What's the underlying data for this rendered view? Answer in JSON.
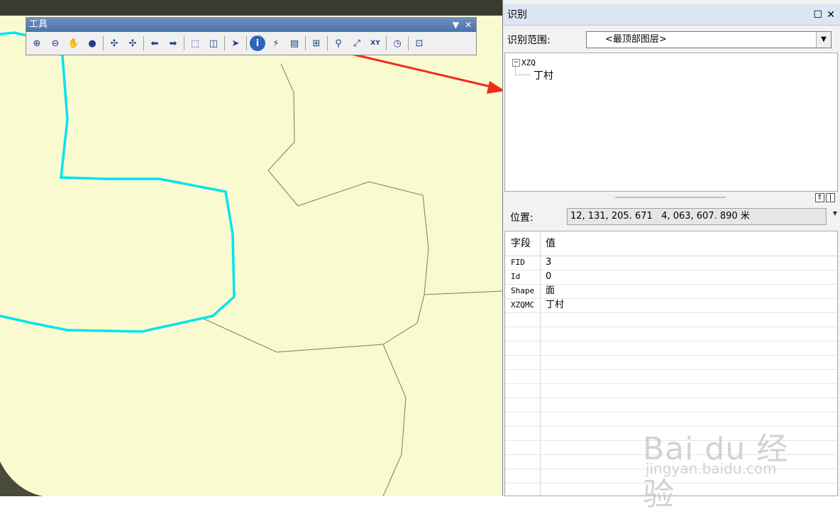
{
  "toolbar": {
    "title": "工具",
    "tools": [
      {
        "icon": "zoom-in-icon",
        "glyph": "⊕"
      },
      {
        "icon": "zoom-out-icon",
        "glyph": "⊖"
      },
      {
        "icon": "pan-hand-icon",
        "glyph": "✋"
      },
      {
        "icon": "full-extent-globe-icon",
        "glyph": "●"
      },
      {
        "icon": "fixed-zoom-in-icon",
        "glyph": "✣"
      },
      {
        "icon": "fixed-zoom-out-icon",
        "glyph": "✣"
      },
      {
        "icon": "back-arrow-icon",
        "glyph": "⬅"
      },
      {
        "icon": "forward-arrow-icon",
        "glyph": "➡"
      },
      {
        "icon": "select-features-icon",
        "glyph": "⬚"
      },
      {
        "icon": "clear-selection-icon",
        "glyph": "◫"
      },
      {
        "icon": "select-elements-pointer-icon",
        "glyph": "➤"
      },
      {
        "icon": "identify-icon",
        "glyph": "i"
      },
      {
        "icon": "hyperlink-icon",
        "glyph": "⚡"
      },
      {
        "icon": "html-popup-icon",
        "glyph": "▤"
      },
      {
        "icon": "measure-icon",
        "glyph": "⊞"
      },
      {
        "icon": "find-binoculars-icon",
        "glyph": "⚲"
      },
      {
        "icon": "find-route-icon",
        "glyph": "⤢"
      },
      {
        "icon": "go-to-xy-icon",
        "glyph": "XY"
      },
      {
        "icon": "time-slider-icon",
        "glyph": "◷"
      },
      {
        "icon": "viewer-window-icon",
        "glyph": "⊡"
      }
    ]
  },
  "identify": {
    "title": "识别",
    "scope_label": "识别范围:",
    "scope_value": "<最顶部图层>",
    "tree": {
      "layer": "XZQ",
      "feature": "丁村"
    },
    "location_label": "位置:",
    "location_value": "12, 131, 205. 671   4, 063, 607. 890 米",
    "grid": {
      "headers": [
        "字段",
        "值"
      ],
      "rows": [
        {
          "field": "FID",
          "value": "3"
        },
        {
          "field": "Id",
          "value": "0"
        },
        {
          "field": "Shape",
          "value": "面"
        },
        {
          "field": "XZQMC",
          "value": "丁村"
        }
      ]
    }
  },
  "watermark": {
    "brand": "Bai du 经验",
    "url": "jingyan.baidu.com"
  },
  "colors": {
    "map_fill": "#fafad0",
    "highlight_outline": "#00e5ee",
    "boundary": "#7a7a6a",
    "arrow": "#ee2c1c"
  }
}
